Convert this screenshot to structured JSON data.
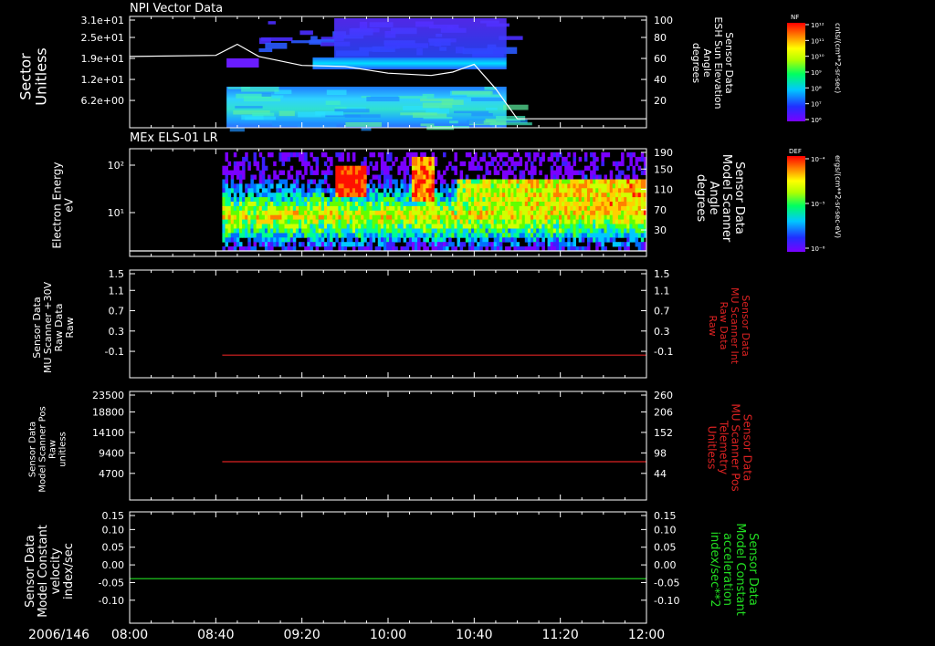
{
  "colors": {
    "background": "#000000",
    "axis": "#ffffff",
    "red_trace": "#dd2222",
    "green_trace": "#22dd22",
    "white_trace": "#ffffff"
  },
  "date": "2006/146",
  "time_ticks": [
    "08:00",
    "08:40",
    "09:20",
    "10:00",
    "10:40",
    "11:20",
    "12:00"
  ],
  "colorbars": {
    "nf": {
      "tag": "NF",
      "unit": "cnts/(cm**2-sr-sec)",
      "ticks": [
        "10¹²",
        "10¹¹",
        "10¹⁰",
        "10⁹",
        "10⁸",
        "10⁷",
        "10⁶"
      ]
    },
    "def": {
      "tag": "DEF",
      "unit": "ergs/(cm**2-sr-sec-eV)",
      "ticks": [
        "10⁻⁴",
        "10⁻⁵",
        "10⁻⁶"
      ]
    }
  },
  "chart_data": [
    {
      "type": "heatmap",
      "title": "NPI Vector Data",
      "ylabel": [
        "Sector",
        "Unitless"
      ],
      "y_ticks": [
        "3.1e+01",
        "2.5e+01",
        "1.9e+01",
        "1.2e+01",
        "6.2e+00"
      ],
      "right_ylabel": [
        "Sensor Data",
        "ESH Sun Elevation",
        "Angle",
        "degrees"
      ],
      "right_ticks": [
        "100",
        "80",
        "60",
        "40",
        "20"
      ],
      "right_ylim": [
        0,
        100
      ],
      "xlim": [
        "08:00",
        "12:00"
      ],
      "data_start": "08:45",
      "data_end": "10:55",
      "overlay_series": {
        "name": "ESH Sun Elevation Angle",
        "x": [
          "08:00",
          "08:40",
          "08:50",
          "09:00",
          "09:20",
          "09:40",
          "10:00",
          "10:20",
          "10:30",
          "10:40",
          "10:50",
          "11:00",
          "11:20",
          "12:00"
        ],
        "y": [
          64,
          65,
          75,
          64,
          56,
          55,
          49,
          47,
          50,
          57,
          35,
          8,
          8,
          8
        ]
      }
    },
    {
      "type": "heatmap",
      "title": "MEx ELS-01 LR",
      "ylabel": [
        "Electron Energy",
        "eV"
      ],
      "y_ticks": [
        "10²",
        "10¹"
      ],
      "right_ylabel": [
        "Sensor Data",
        "Model Scanner",
        "Angle",
        "degrees"
      ],
      "right_ticks": [
        "190",
        "150",
        "110",
        "70",
        "30"
      ],
      "right_ylim": [
        10,
        190
      ],
      "xlim": [
        "08:00",
        "12:00"
      ],
      "data_start": "08:43",
      "data_end": "12:00",
      "overlay_series": {
        "name": "Model Scanner Angle",
        "x": [
          "08:00",
          "12:00"
        ],
        "y": [
          10,
          10
        ]
      }
    },
    {
      "type": "line",
      "ylabel": [
        "Sensor Data",
        "MU Scanner +30V",
        "Raw Data",
        "Raw"
      ],
      "y_ticks": [
        "1.5",
        "1.1",
        "0.7",
        "0.3",
        "-0.1"
      ],
      "ylim": [
        -0.4,
        1.5
      ],
      "right_ylabel": [
        "Sensor Data",
        "MU Scanner Int",
        "Raw Data",
        "Raw"
      ],
      "right_ticks": [
        "1.5",
        "1.1",
        "0.7",
        "0.3",
        "-0.1"
      ],
      "xlim": [
        "08:00",
        "12:00"
      ],
      "series": [
        {
          "x": [
            "08:43",
            "12:00"
          ],
          "y": [
            0.0,
            0.0
          ],
          "color": "#dd2222"
        }
      ]
    },
    {
      "type": "line",
      "ylabel": [
        "Sensor Data",
        "Model Scanner Pos",
        "Raw",
        "unitless"
      ],
      "y_ticks": [
        "23500",
        "18800",
        "14100",
        "9400",
        "4700"
      ],
      "ylim": [
        0,
        23500
      ],
      "right_ylabel": [
        "Sensor Data",
        "MU Scanner Pos",
        "Telemetry",
        "Unitless"
      ],
      "right_ticks": [
        "260",
        "206",
        "152",
        "98",
        "44"
      ],
      "xlim": [
        "08:00",
        "12:00"
      ],
      "series": [
        {
          "x": [
            "08:43",
            "12:00"
          ],
          "y": [
            8300,
            8300
          ],
          "color": "#dd2222"
        }
      ]
    },
    {
      "type": "line",
      "ylabel": [
        "Sensor Data",
        "Model Constant",
        "velocity",
        "index/sec"
      ],
      "y_ticks": [
        "0.15",
        "0.10",
        "0.05",
        "0.00",
        "-0.05",
        "-0.10"
      ],
      "ylim": [
        -0.1,
        0.15
      ],
      "right_ylabel": [
        "Sensor Data",
        "Model Constant",
        "acceleration",
        "index/sec**2"
      ],
      "right_ticks": [
        "0.15",
        "0.10",
        "0.05",
        "0.00",
        "-0.05",
        "-0.10"
      ],
      "xlim": [
        "08:00",
        "12:00"
      ],
      "series": [
        {
          "x": [
            "08:00",
            "12:00"
          ],
          "y": [
            0.0,
            0.0
          ],
          "color": "#22dd22"
        }
      ]
    }
  ]
}
